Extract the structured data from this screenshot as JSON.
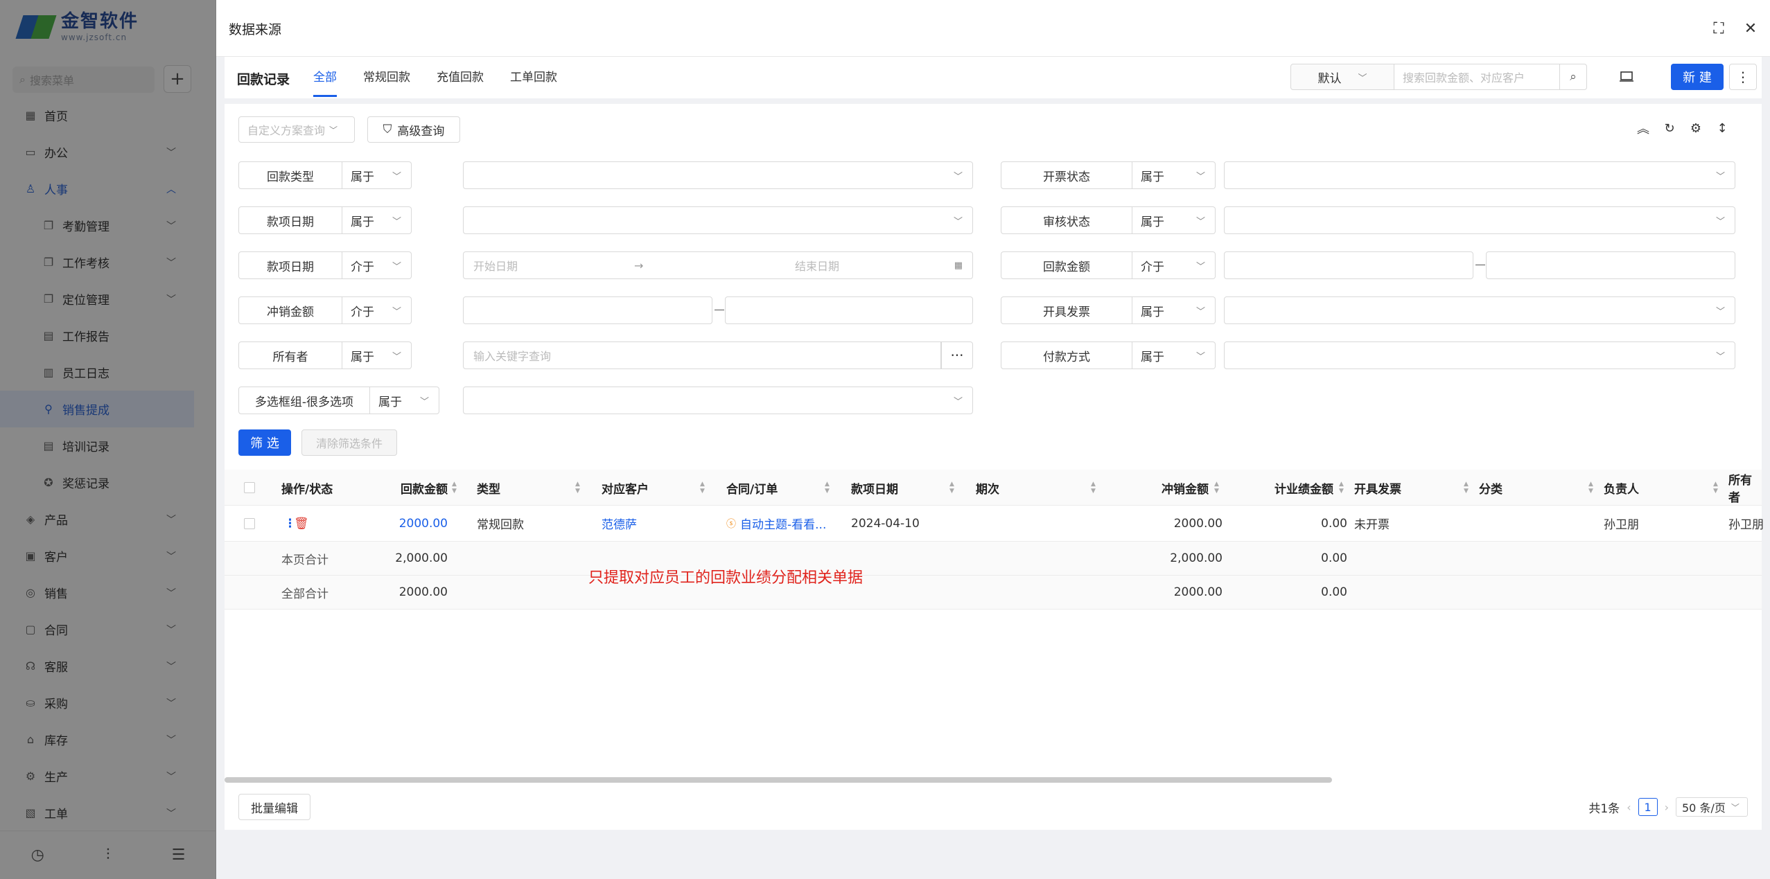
{
  "app": {
    "logo_title": "金智软件",
    "logo_sub": "www.jzsoft.cn",
    "brand_colors": {
      "blue": "#2b6cc4",
      "green": "#4fb54a",
      "accent": "#1a5fe8",
      "annotation": "#e0231c"
    }
  },
  "sidebar": {
    "search_placeholder": "搜索菜单",
    "add_label": "+",
    "items": [
      {
        "label": "首页",
        "icon": "grid-icon"
      },
      {
        "label": "办公",
        "icon": "office-icon"
      },
      {
        "label": "人事",
        "icon": "person-icon"
      },
      {
        "label": "考勤管理",
        "icon": "copy-icon"
      },
      {
        "label": "工作考核",
        "icon": "copy-icon"
      },
      {
        "label": "定位管理",
        "icon": "copy-icon"
      },
      {
        "label": "工作报告",
        "icon": "doc-icon"
      },
      {
        "label": "员工日志",
        "icon": "calendar-icon"
      },
      {
        "label": "销售提成",
        "icon": "commission-icon"
      },
      {
        "label": "培训记录",
        "icon": "doc-icon"
      },
      {
        "label": "奖惩记录",
        "icon": "award-icon"
      },
      {
        "label": "产品",
        "icon": "box-icon"
      },
      {
        "label": "客户",
        "icon": "customer-icon"
      },
      {
        "label": "销售",
        "icon": "sales-icon"
      },
      {
        "label": "合同",
        "icon": "contract-icon"
      },
      {
        "label": "客服",
        "icon": "service-icon"
      },
      {
        "label": "采购",
        "icon": "purchase-icon"
      },
      {
        "label": "库存",
        "icon": "warehouse-icon"
      },
      {
        "label": "生产",
        "icon": "production-icon"
      },
      {
        "label": "工单",
        "icon": "workorder-icon"
      }
    ]
  },
  "modal": {
    "title": "数据来源",
    "record_title": "回款记录",
    "tabs": [
      "全部",
      "常规回款",
      "充值回款",
      "工单回款"
    ],
    "active_tab": 0,
    "view_select": "默认",
    "search_placeholder": "搜索回款金额、对应客户",
    "new_button": "新 建",
    "more_button": "⋮"
  },
  "filters": {
    "scheme_placeholder": "自定义方案查询",
    "advanced_label": "高级查询",
    "rows": [
      {
        "label": "回款类型",
        "op": "属于"
      },
      {
        "label": "开票状态",
        "op": "属于"
      },
      {
        "label": "款项日期",
        "op": "属于"
      },
      {
        "label": "审核状态",
        "op": "属于"
      },
      {
        "label": "款项日期",
        "op": "介于",
        "start_placeholder": "开始日期",
        "end_placeholder": "结束日期"
      },
      {
        "label": "回款金额",
        "op": "介于"
      },
      {
        "label": "冲销金额",
        "op": "介于"
      },
      {
        "label": "开具发票",
        "op": "属于"
      },
      {
        "label": "所有者",
        "op": "属于",
        "placeholder": "输入关键字查询"
      },
      {
        "label": "付款方式",
        "op": "属于"
      },
      {
        "label": "多选框组-很多选项",
        "op": "属于"
      }
    ],
    "filter_button": "筛 选",
    "clear_button": "清除筛选条件"
  },
  "table": {
    "columns": [
      "操作/状态",
      "回款金额",
      "类型",
      "对应客户",
      "合同/订单",
      "款项日期",
      "期次",
      "冲销金额",
      "计业绩金额",
      "开具发票",
      "分类",
      "负责人",
      "所有者"
    ],
    "rows": [
      {
        "amount": "2000.00",
        "type": "常规回款",
        "customer": "范德萨",
        "contract": "自动主题-看看...",
        "date": "2024-04-10",
        "period": "",
        "writeoff": "2000.00",
        "perf": "0.00",
        "invoice": "未开票",
        "category": "",
        "owner": "孙卫朋",
        "holder": "孙卫朋"
      }
    ],
    "page_total": {
      "label": "本页合计",
      "amount": "2,000.00",
      "writeoff": "2,000.00",
      "perf": "0.00"
    },
    "all_total": {
      "label": "全部合计",
      "amount": "2000.00",
      "writeoff": "2000.00",
      "perf": "0.00"
    }
  },
  "annotation": "只提取对应员工的回款业绩分配相关单据",
  "footer": {
    "batch_edit": "批量编辑",
    "total": "共1条",
    "page": "1",
    "page_size": "50 条/页"
  }
}
